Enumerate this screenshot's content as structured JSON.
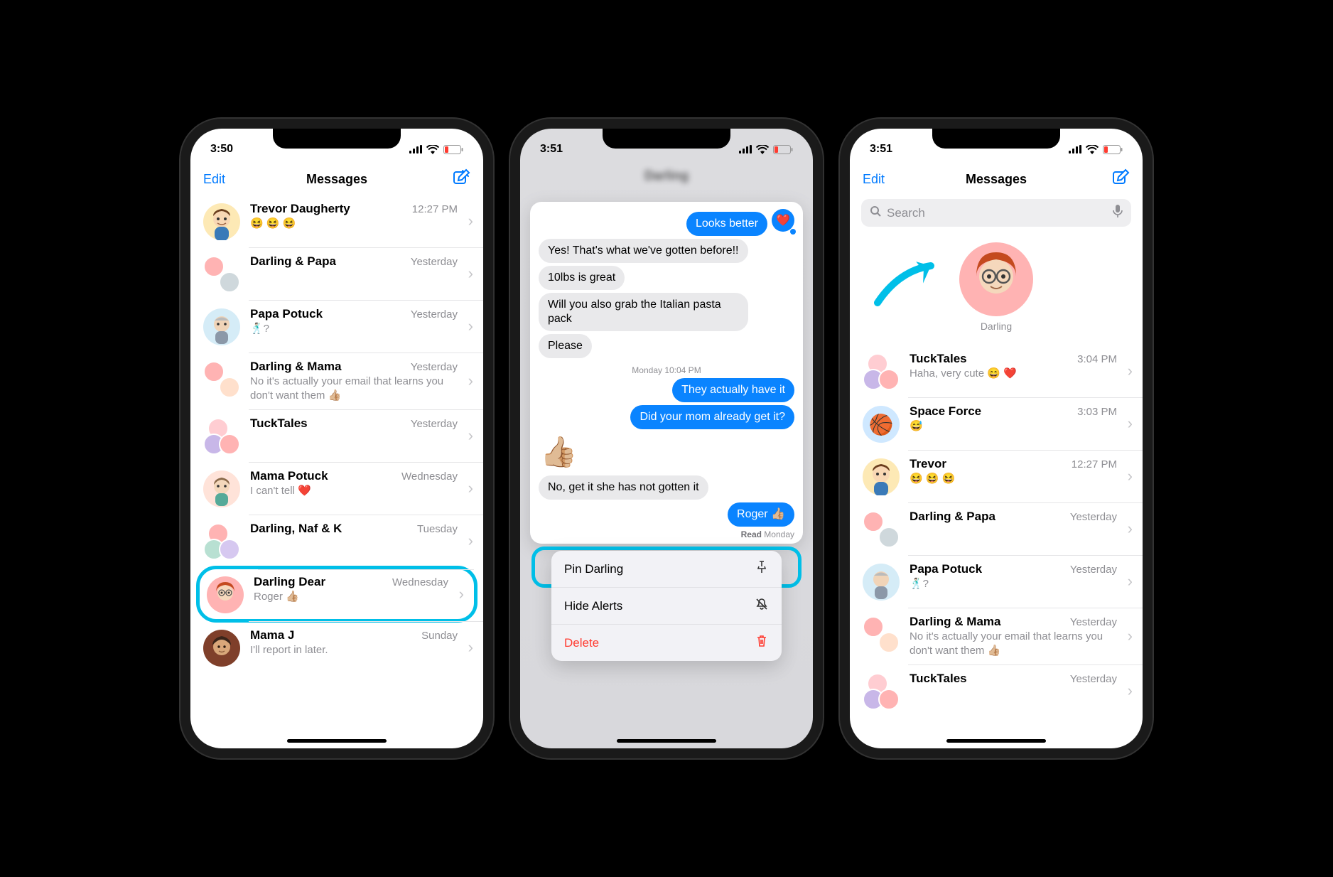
{
  "phone1": {
    "status_time": "3:50",
    "nav": {
      "edit": "Edit",
      "title": "Messages"
    },
    "conversations": [
      {
        "name": "Trevor Daugherty",
        "time": "12:27 PM",
        "preview": "😆 😆 😆"
      },
      {
        "name": "Darling & Papa",
        "time": "Yesterday",
        "preview": " "
      },
      {
        "name": "Papa Potuck",
        "time": "Yesterday",
        "preview": "🕺🏻?"
      },
      {
        "name": "Darling & Mama",
        "time": "Yesterday",
        "preview": "No it's actually your email that learns you don't want them 👍🏼"
      },
      {
        "name": "TuckTales",
        "time": "Yesterday",
        "preview": " "
      },
      {
        "name": "Mama Potuck",
        "time": "Wednesday",
        "preview": "I can't tell ❤️"
      },
      {
        "name": "Darling, Naf & K",
        "time": "Tuesday",
        "preview": " "
      },
      {
        "name": "Darling Dear",
        "time": "Wednesday",
        "preview": "Roger 👍🏼"
      },
      {
        "name": "Mama J",
        "time": "Sunday",
        "preview": "I'll report in later."
      }
    ]
  },
  "phone2": {
    "status_time": "3:51",
    "blurred_title": "Darling",
    "preview": {
      "out_top": "Looks better",
      "in1": "Yes! That's what we've gotten before!!",
      "in2": "10lbs is great",
      "in3": "Will you also grab the Italian pasta pack",
      "in4": "Please",
      "ts": "Monday 10:04 PM",
      "out2": "They actually have it",
      "out3": "Did your mom already get it?",
      "thumbs": "👍🏼",
      "in5": "No, get it she has not gotten it",
      "out4": "Roger 👍🏼",
      "receipt_label": "Read",
      "receipt_time": "Monday"
    },
    "menu": {
      "pin": "Pin Darling",
      "hide": "Hide Alerts",
      "delete": "Delete"
    }
  },
  "phone3": {
    "status_time": "3:51",
    "nav": {
      "edit": "Edit",
      "title": "Messages"
    },
    "search_placeholder": "Search",
    "pin": {
      "name": "Darling"
    },
    "conversations": [
      {
        "name": "TuckTales",
        "time": "3:04 PM",
        "preview": "Haha, very cute 😄 ❤️"
      },
      {
        "name": "Space Force",
        "time": "3:03 PM",
        "preview": "😅"
      },
      {
        "name": "Trevor",
        "time": "12:27 PM",
        "preview": "😆 😆 😆"
      },
      {
        "name": "Darling & Papa",
        "time": "Yesterday",
        "preview": " "
      },
      {
        "name": "Papa Potuck",
        "time": "Yesterday",
        "preview": "🕺🏻?"
      },
      {
        "name": "Darling & Mama",
        "time": "Yesterday",
        "preview": "No it's actually your email that learns you don't want them 👍🏼"
      },
      {
        "name": "TuckTales",
        "time": "Yesterday",
        "preview": " "
      }
    ]
  }
}
